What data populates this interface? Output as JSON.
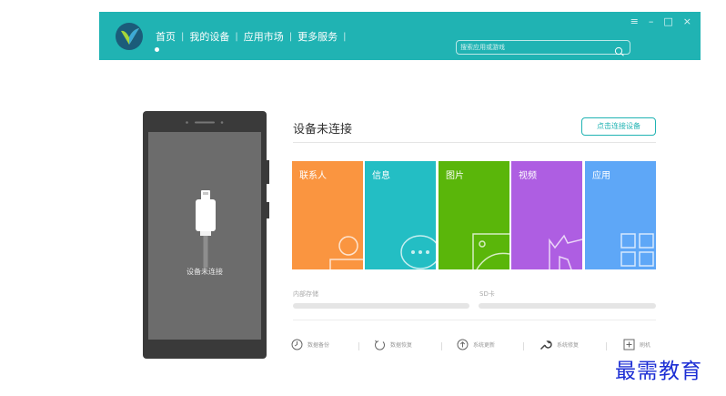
{
  "nav": {
    "items": [
      {
        "label": "首页"
      },
      {
        "label": "我的设备"
      },
      {
        "label": "应用市场"
      },
      {
        "label": "更多服务"
      }
    ],
    "separator": "|"
  },
  "search": {
    "placeholder": "搜索应用或游戏"
  },
  "window_controls": {
    "menu": "≡",
    "minimize": "–",
    "maximize": "□",
    "close": "×"
  },
  "phone": {
    "status": "设备未连接"
  },
  "device": {
    "title": "设备未连接",
    "connect_button": "点击连接设备"
  },
  "tiles": [
    {
      "label": "联系人",
      "color": "#fa9540"
    },
    {
      "label": "信息",
      "color": "#23bec4"
    },
    {
      "label": "图片",
      "color": "#5ab60a"
    },
    {
      "label": "视频",
      "color": "#ae5ee2"
    },
    {
      "label": "应用",
      "color": "#5ea7f7"
    }
  ],
  "storage": {
    "internal": "内部存储",
    "sd": "SD卡"
  },
  "tools": [
    {
      "label": "数据备份",
      "icon": "clock-icon"
    },
    {
      "label": "数据恢复",
      "icon": "restore-icon"
    },
    {
      "label": "系统更新",
      "icon": "update-icon"
    },
    {
      "label": "系统修复",
      "icon": "wrench-icon"
    },
    {
      "label": "刷机",
      "icon": "flash-icon"
    }
  ],
  "watermark": "最需教育",
  "colors": {
    "accent": "#20b3b3",
    "phone": "#3a3a3a",
    "screen": "#6c6c6c"
  }
}
